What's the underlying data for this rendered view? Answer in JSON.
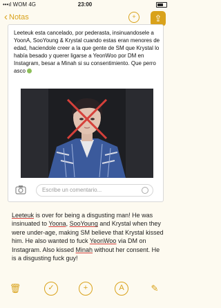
{
  "status_bar": {
    "carrier": "WOM",
    "network": "4G",
    "time": "23:00",
    "battery_glyph": "battery-icon"
  },
  "nav": {
    "back_label": "Notas",
    "share_people_icon": "person-plus-icon",
    "share_icon": "share-icon"
  },
  "card": {
    "text": "Leeteuk esta cancelado, por pederasta, insinuandosele a YoonA, SooYoung & Krystal cuando estas eran menores de edad, haciendole creer a la que gente de SM que Krystal lo había besado y querer ligarse a YeonWoo por DM en Instagram, besar a Minah si su consentimiento. Que perro asco",
    "comment_placeholder": "Escribe un comentario..."
  },
  "note": {
    "segments": [
      {
        "text": "Leeteuk",
        "u": true
      },
      {
        "text": " is over for being a disgusting man! He was insinuated to ",
        "u": false
      },
      {
        "text": "Yoona",
        "u": true
      },
      {
        "text": ", ",
        "u": false
      },
      {
        "text": "SooYoung",
        "u": true
      },
      {
        "text": " and Krystal when they were under-age, making SM believe that Krystal kissed him. He also wanted to fuck ",
        "u": false
      },
      {
        "text": "YeonWoo",
        "u": true
      },
      {
        "text": " via DM on Instagram. Also kissed ",
        "u": false
      },
      {
        "text": "Minah",
        "u": true
      },
      {
        "text": " without her consent. He is a disgusting fuck guy!",
        "u": false
      }
    ]
  },
  "toolbar": {
    "items": [
      {
        "icon": "trash-icon",
        "glyph": "🗑"
      },
      {
        "icon": "checklist-icon",
        "glyph": "✓"
      },
      {
        "icon": "add-icon",
        "glyph": "+"
      },
      {
        "icon": "sketch-icon",
        "glyph": "A"
      },
      {
        "icon": "compose-icon",
        "glyph": "✎"
      }
    ]
  },
  "colors": {
    "accent": "#d9a21b",
    "background": "#fdfaf0",
    "cross": "#d6403a"
  }
}
